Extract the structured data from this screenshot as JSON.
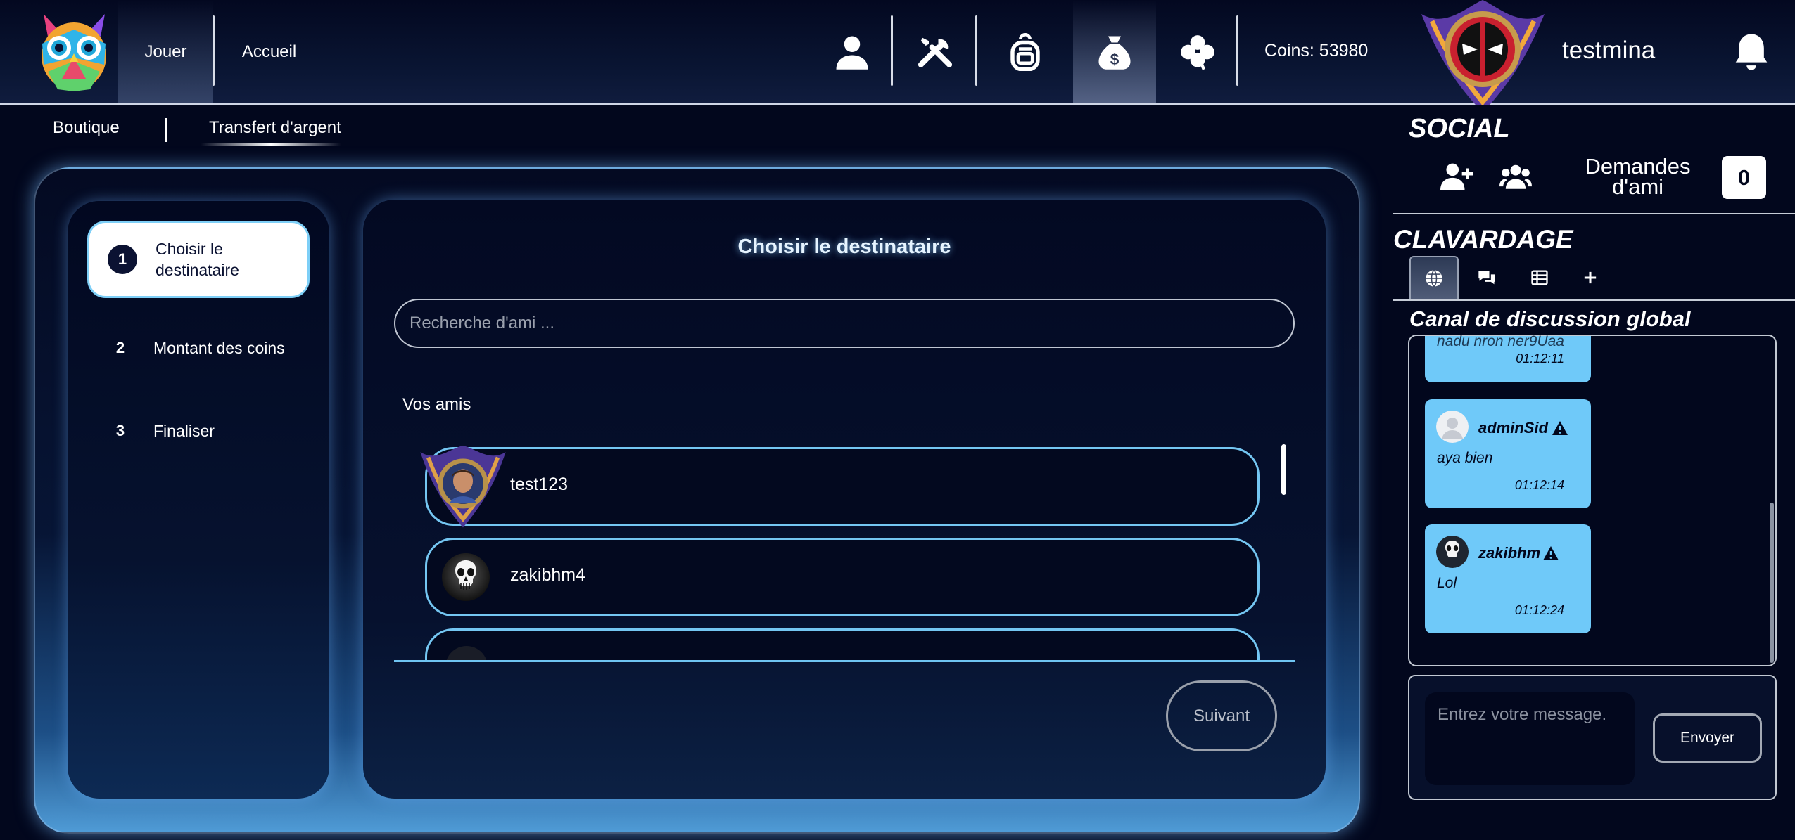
{
  "header": {
    "nav": {
      "play": "Jouer",
      "home": "Accueil"
    },
    "icons": [
      "user-icon",
      "tools-icon",
      "backpack-icon",
      "money-bag-icon",
      "clover-icon"
    ],
    "active_icon": "money-bag-icon",
    "coins": "Coins: 53980",
    "username": "testmina"
  },
  "subnav": {
    "shop": "Boutique",
    "transfer": "Transfert d'argent",
    "active": "transfer"
  },
  "steps": [
    {
      "num": "1",
      "label": "Choisir le destinataire",
      "active": true
    },
    {
      "num": "2",
      "label": "Montant des coins",
      "active": false
    },
    {
      "num": "3",
      "label": "Finaliser",
      "active": false
    }
  ],
  "main": {
    "title": "Choisir le destinataire",
    "search_placeholder": "Recherche d'ami ...",
    "friends_label": "Vos amis",
    "friends": [
      {
        "name": "test123"
      },
      {
        "name": "zakibhm4"
      },
      {
        "name": ""
      }
    ],
    "next_label": "Suivant"
  },
  "social": {
    "title": "SOCIAL",
    "friend_requests_label": "Demandes d'ami",
    "friend_requests_count": "0"
  },
  "chat": {
    "title": "CLAVARDAGE",
    "channel_title": "Canal de discussion global",
    "messages": [
      {
        "user": "",
        "text": "nadu nron ner9Uaa",
        "time": "01:12:11"
      },
      {
        "user": "adminSid",
        "text": "aya bien",
        "time": "01:12:14"
      },
      {
        "user": "zakibhm",
        "text": "Lol",
        "time": "01:12:24"
      }
    ],
    "input_placeholder": "Entrez votre message.",
    "send_label": "Envoyer"
  },
  "colors": {
    "background": "#02071d",
    "accent": "#6fc9f9",
    "friend_border": "#74c6f2"
  }
}
